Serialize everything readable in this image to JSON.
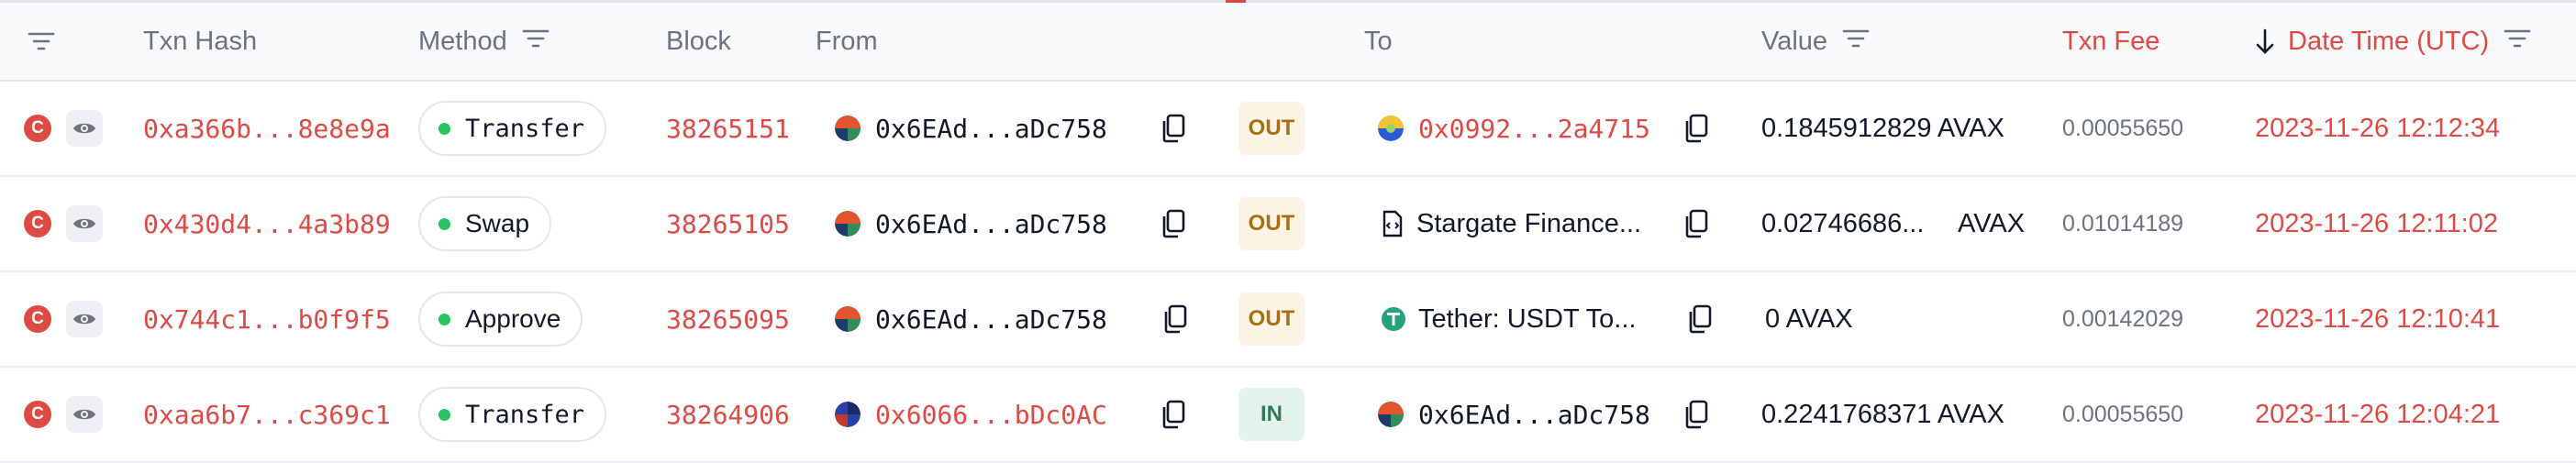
{
  "header": {
    "txn_hash": "Txn Hash",
    "method": "Method",
    "block": "Block",
    "from": "From",
    "to": "To",
    "value": "Value",
    "txn_fee": "Txn Fee",
    "date_time": "Date Time (UTC)"
  },
  "colors": {
    "accent_red": "#dc4a43",
    "out_bg": "#fbf4e4",
    "in_bg": "#e3f4ec",
    "method_dot": "#22c55e"
  },
  "rows": [
    {
      "status_badge": "C",
      "hash": "0xa366b...8e8e9a",
      "method": "Transfer",
      "block": "38265151",
      "from": "0x6EAd...aDc758",
      "direction": "OUT",
      "to": "0x0992...2a4715",
      "to_icon": "token-avatar-icon",
      "value": "0.1845912829 AVAX",
      "fee": "0.00055650",
      "date": "2023-11-26 12:12:34"
    },
    {
      "status_badge": "C",
      "hash": "0x430d4...4a3b89",
      "method": "Swap",
      "block": "38265105",
      "from": "0x6EAd...aDc758",
      "direction": "OUT",
      "to": "Stargate Finance...",
      "to_icon": "contract-file-icon",
      "value_amount": "0.02746686...",
      "value_unit": "AVAX",
      "fee": "0.01014189",
      "date": "2023-11-26 12:11:02"
    },
    {
      "status_badge": "C",
      "hash": "0x744c1...b0f9f5",
      "method": "Approve",
      "block": "38265095",
      "from": "0x6EAd...aDc758",
      "direction": "OUT",
      "to": "Tether: USDT To...",
      "to_icon": "tether-logo-icon",
      "value": "0 AVAX",
      "fee": "0.00142029",
      "date": "2023-11-26 12:10:41"
    },
    {
      "status_badge": "C",
      "hash": "0xaa6b7...c369c1",
      "method": "Transfer",
      "block": "38264906",
      "from": "0x6066...bDc0AC",
      "direction": "IN",
      "to": "0x6EAd...aDc758",
      "to_icon": "address-avatar-icon",
      "value": "0.2241768371 AVAX",
      "fee": "0.00055650",
      "date": "2023-11-26 12:04:21"
    }
  ]
}
